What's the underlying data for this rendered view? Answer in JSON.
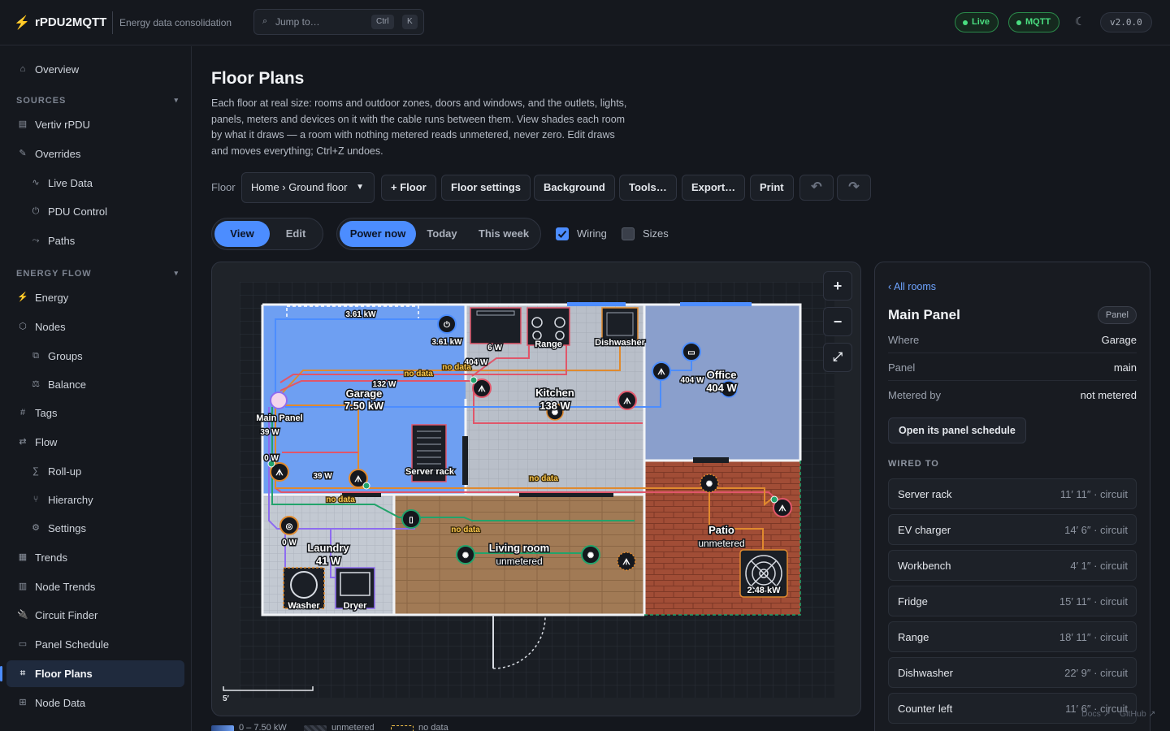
{
  "app": {
    "name": "rPDU2MQTT",
    "subtitle": "Energy data consolidation"
  },
  "search": {
    "placeholder": "Jump to…",
    "key1": "Ctrl",
    "key2": "K"
  },
  "status": {
    "live": "Live",
    "mqtt": "MQTT",
    "version": "v2.0.0"
  },
  "sidebar": {
    "overview": "Overview",
    "sources_title": "SOURCES",
    "sources": [
      "Vertiv rPDU",
      "Overrides",
      "Live Data",
      "PDU Control",
      "Paths"
    ],
    "energy_title": "ENERGY FLOW",
    "energy": [
      "Energy",
      "Nodes",
      "Groups",
      "Balance",
      "Tags",
      "Flow",
      "Roll-up",
      "Hierarchy",
      "Settings",
      "Trends",
      "Node Trends",
      "Circuit Finder",
      "Panel Schedule",
      "Floor Plans",
      "Node Data"
    ]
  },
  "page": {
    "title": "Floor Plans",
    "description": "Each floor at real size: rooms and outdoor zones, doors and windows, and the outlets, lights, panels, meters and devices on it with the cable runs between them. View shades each room by what it draws — a room with nothing metered reads unmetered, never zero. Edit draws and moves everything; Ctrl+Z undoes."
  },
  "toolbar": {
    "floor_label": "Floor",
    "floor_value": "Home › Ground floor",
    "buttons": [
      "+ Floor",
      "Floor settings",
      "Background",
      "Tools…",
      "Export…",
      "Print"
    ]
  },
  "modes": {
    "view": "View",
    "edit": "Edit"
  },
  "ranges": {
    "now": "Power now",
    "today": "Today",
    "week": "This week"
  },
  "toggles": {
    "wiring": "Wiring",
    "sizes": "Sizes"
  },
  "plan": {
    "rooms": {
      "garage": {
        "name": "Garage",
        "value": "7.50 kW"
      },
      "kitchen": {
        "name": "Kitchen",
        "value": "138 W"
      },
      "office": {
        "name": "Office",
        "value": "404 W"
      },
      "patio": {
        "name": "Patio",
        "value": "unmetered"
      },
      "laundry": {
        "name": "Laundry",
        "value": "41 W"
      },
      "living": {
        "name": "Living room",
        "value": "unmetered"
      }
    },
    "devices": {
      "panel": "Main Panel",
      "server": "Server rack",
      "range": "Range",
      "dishwasher": "Dishwasher",
      "washer": "Washer",
      "dryer": "Dryer",
      "ev": "2.48 kW"
    },
    "labels": {
      "top_run": "3.61 kW",
      "ev_charger": "3.61 kW",
      "fridge": "6 W",
      "w404a": "404 W",
      "w404b": "404 W",
      "nodata": "no data",
      "w132": "132 W",
      "w39a": "39 W",
      "w39b": "39 W",
      "w0a": "0 W",
      "w0b": "0 W",
      "scale": "5′"
    }
  },
  "details": {
    "back": "‹ All rooms",
    "title": "Main Panel",
    "badge": "Panel",
    "rows": [
      {
        "k": "Where",
        "v": "Garage"
      },
      {
        "k": "Panel",
        "v": "main"
      },
      {
        "k": "Metered by",
        "v": "not metered"
      }
    ],
    "action": "Open its panel schedule",
    "wired_title": "WIRED TO",
    "wired": [
      {
        "name": "Server rack",
        "dist": "11′ 11″ · circuit"
      },
      {
        "name": "EV charger",
        "dist": "14′ 6″ · circuit"
      },
      {
        "name": "Workbench",
        "dist": "4′ 1″ · circuit"
      },
      {
        "name": "Fridge",
        "dist": "15′ 11″ · circuit"
      },
      {
        "name": "Range",
        "dist": "18′ 11″ · circuit"
      },
      {
        "name": "Dishwasher",
        "dist": "22′ 9″ · circuit"
      },
      {
        "name": "Counter left",
        "dist": "11′ 6″ · circuit"
      }
    ]
  },
  "legend": {
    "range": "0 – 7.50 kW",
    "unmetered": "unmetered",
    "nodata": "no data"
  },
  "footer": {
    "docs": "Docs ↗",
    "github": "GitHub ↗"
  },
  "colors": {
    "accent": "#4c8dff",
    "live": "#4ade80",
    "wire_red": "#e0566a",
    "wire_orange": "#e08a2e",
    "wire_blue": "#4c8dff",
    "wire_green": "#22a36b"
  }
}
